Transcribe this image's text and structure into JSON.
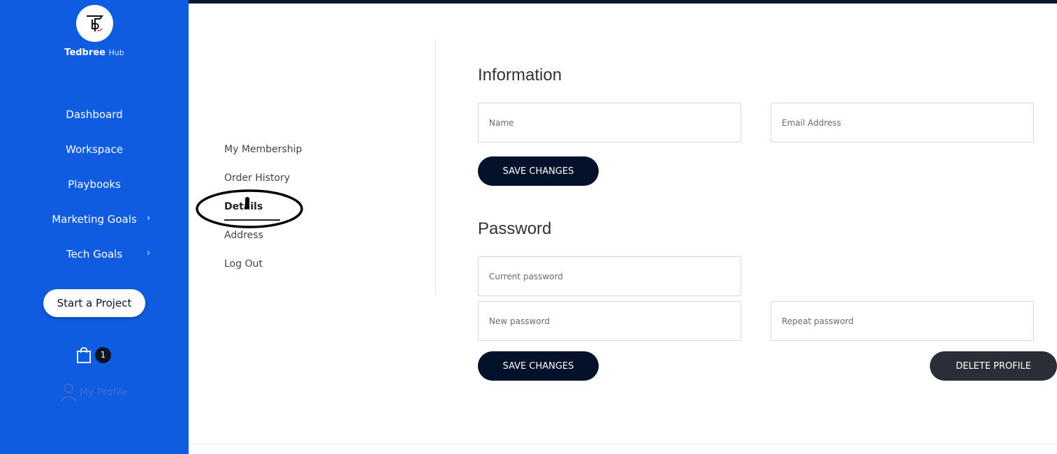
{
  "brand": {
    "name": "Tedbree",
    "suffix": "Hub"
  },
  "sidebar": {
    "nav": [
      {
        "label": "Dashboard"
      },
      {
        "label": "Workspace"
      },
      {
        "label": "Playbooks"
      },
      {
        "label": "Marketing Goals",
        "has_submenu": true
      },
      {
        "label": "Tech Goals",
        "has_submenu": true
      }
    ],
    "start_project_label": "Start a Project",
    "cart_count": "1",
    "profile_label": "My Profile"
  },
  "account_menu": {
    "items": [
      {
        "label": "My Membership"
      },
      {
        "label": "Order History"
      },
      {
        "label": "Details",
        "active": true
      },
      {
        "label": "Address"
      },
      {
        "label": "Log Out"
      }
    ]
  },
  "information": {
    "title": "Information",
    "name_placeholder": "Name",
    "email_placeholder": "Email Address",
    "save_label": "SAVE CHANGES"
  },
  "password": {
    "title": "Password",
    "current_placeholder": "Current password",
    "new_placeholder": "New password",
    "repeat_placeholder": "Repeat password",
    "save_label": "SAVE CHANGES",
    "delete_label": "DELETE PROFILE"
  },
  "colors": {
    "sidebar_bg": "#0f5ce0",
    "button_dark": "#03112b",
    "delete_button": "#2a2f37"
  },
  "icons": [
    "tedbree-logo",
    "chevron-right-icon",
    "shopping-bag-icon",
    "user-icon"
  ]
}
